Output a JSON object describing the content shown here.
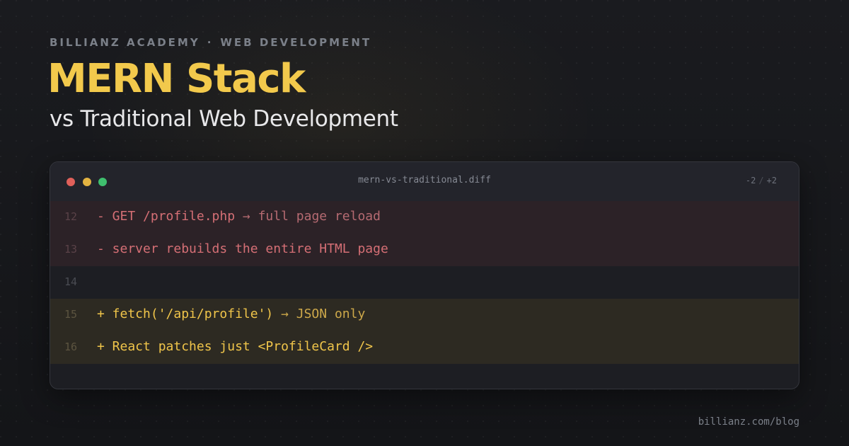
{
  "header": {
    "eyebrow_brand": "BILLIANZ ACADEMY",
    "eyebrow_separator": "·",
    "eyebrow_category": "WEB DEVELOPMENT",
    "title": "MERN Stack",
    "subtitle": "vs Traditional Web Development"
  },
  "editor": {
    "filename": "mern-vs-traditional.diff",
    "diffstat": {
      "removed": "-2",
      "separator": "/",
      "added": "+2"
    },
    "lines": [
      {
        "number": "12",
        "type": "removed",
        "code": "- GET /profile.php",
        "annotation": " → full page reload"
      },
      {
        "number": "13",
        "type": "removed",
        "code": "- server rebuilds the entire HTML page",
        "annotation": ""
      },
      {
        "number": "14",
        "type": "context",
        "code": "",
        "annotation": ""
      },
      {
        "number": "15",
        "type": "added",
        "code": "+ fetch('/api/profile')",
        "annotation": " → JSON only"
      },
      {
        "number": "16",
        "type": "added",
        "code": "+ React patches just <ProfileCard />",
        "annotation": ""
      }
    ]
  },
  "footer": {
    "link": "billianz.com/blog"
  },
  "colors": {
    "accent": "#f2c94c",
    "removed_text": "#d56f75",
    "added_text": "#f0c54a",
    "background": "#17181b"
  }
}
